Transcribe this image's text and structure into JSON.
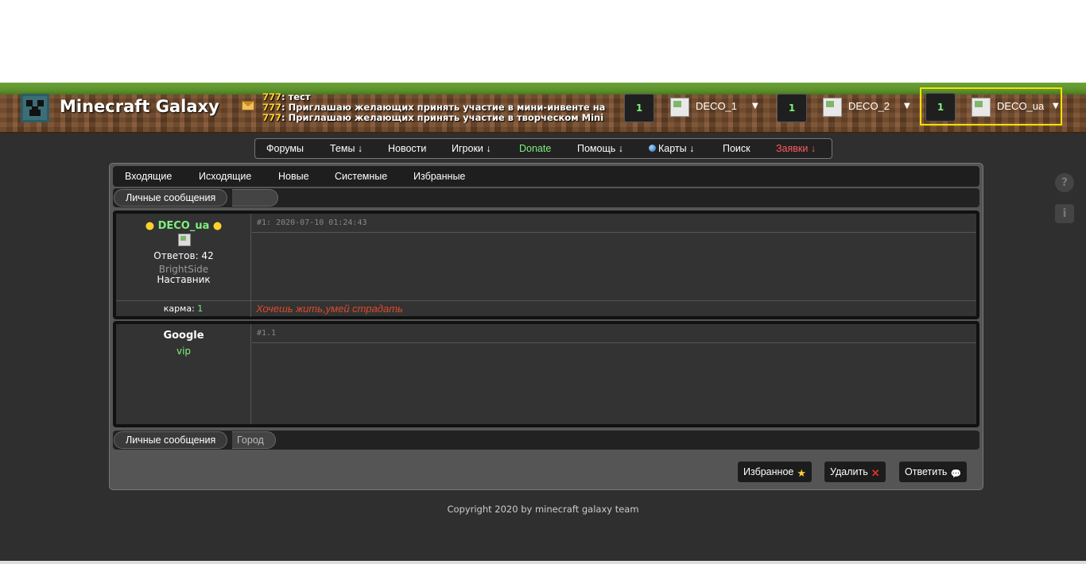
{
  "site": {
    "title": "Minecraft Galaxy"
  },
  "news": [
    {
      "author": "777",
      "text": ": тест"
    },
    {
      "author": "777",
      "text": ": Приглашаю желающих принять участие в мини-инвенте на об"
    },
    {
      "author": "777",
      "text": ": Приглашаю желающих принять участие в творческом Mini Eve"
    }
  ],
  "accounts": [
    {
      "count": "1",
      "name": "DECO_1"
    },
    {
      "count": "1",
      "name": "DECO_2"
    },
    {
      "count": "1",
      "name": "DECO_ua"
    }
  ],
  "caret": "▼",
  "nav": {
    "forums": "Форумы",
    "topics": "Темы ↓",
    "news": "Новости",
    "players": "Игроки ↓",
    "donate": "Donate",
    "help": "Помощь ↓",
    "maps": "Карты ↓",
    "search": "Поиск",
    "requests": "Заявки ↓"
  },
  "tabs": {
    "inbox": "Входящие",
    "outbox": "Исходящие",
    "new": "Новые",
    "system": "Системные",
    "favorites": "Избранные"
  },
  "breadcrumb_top": {
    "c1": "Личные сообщения"
  },
  "breadcrumb_bottom": {
    "c1": "Личные сообщения",
    "c2": "Город"
  },
  "post1": {
    "dot_left": "●",
    "dot_right": "●",
    "author": "DECO_ua",
    "replies": "Ответов: 42",
    "group": "BrightSide",
    "rank": "Наставник",
    "meta": "#1: 2020-07-10 01:24:43",
    "karma_label": "карма: ",
    "karma_value": "1",
    "signature": "Хочешь жить,умей страдать"
  },
  "post2": {
    "author": "Google",
    "rank": "vip",
    "meta": "#1.1"
  },
  "buttons": {
    "favorite": "Избранное",
    "delete": "Удалить",
    "reply": "Ответить"
  },
  "icons": {
    "favorite": "★",
    "delete": "✕",
    "reply": "💬",
    "help": "?",
    "info": "i"
  },
  "colors": {
    "green": "#7ef07e",
    "highlight": "#f2e200",
    "signature": "#e04a2a"
  },
  "footer": "Copyright 2020 by minecraft galaxy team"
}
